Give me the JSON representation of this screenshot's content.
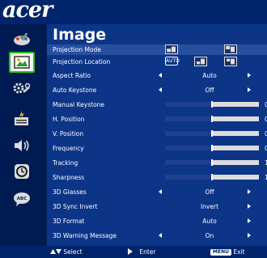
{
  "brand": "acer",
  "menu_title": "Image",
  "categories": [
    {
      "name": "color-icon"
    },
    {
      "name": "image-icon",
      "selected": true
    },
    {
      "name": "settings-icon"
    },
    {
      "name": "management-icon"
    },
    {
      "name": "audio-icon"
    },
    {
      "name": "timer-icon"
    },
    {
      "name": "language-icon"
    }
  ],
  "items": {
    "projection_mode": {
      "label": "Projection Mode"
    },
    "projection_location": {
      "label": "Projection Location",
      "auto_label": "AUTO"
    },
    "aspect_ratio": {
      "label": "Aspect Ratio",
      "value": "Auto"
    },
    "auto_keystone": {
      "label": "Auto Keystone",
      "value": "Off"
    },
    "manual_keystone": {
      "label": "Manual Keystone",
      "value": "0",
      "level_fraction": 0.5
    },
    "h_position": {
      "label": "H. Position",
      "value": "0",
      "level_fraction": 0.5
    },
    "v_position": {
      "label": "V. Position",
      "value": "0",
      "level_fraction": 0.5
    },
    "frequency": {
      "label": "Frequency",
      "value": "0",
      "level_fraction": 0.5
    },
    "tracking": {
      "label": "Tracking",
      "value": "16",
      "level_fraction": 0.5
    },
    "sharpness": {
      "label": "Sharpness",
      "value": "16",
      "level_fraction": 0.5
    },
    "glasses_3d": {
      "label": "3D Glasses",
      "value": "Off"
    },
    "sync_invert_3d": {
      "label": "3D Sync Invert",
      "value": "Invert"
    },
    "format_3d": {
      "label": "3D Format",
      "value": "Auto"
    },
    "warning_3d": {
      "label": "3D Warning Message",
      "value": "On"
    }
  },
  "footer": {
    "select": "Select",
    "enter": "Enter",
    "menu_key": "MENU",
    "exit": "Exit"
  },
  "colors": {
    "background": "#00246b",
    "panel": "#0c3588",
    "highlight_row": "#274fa0",
    "selected_border": "#28c21c",
    "slider_track": "#dcdcdc"
  }
}
